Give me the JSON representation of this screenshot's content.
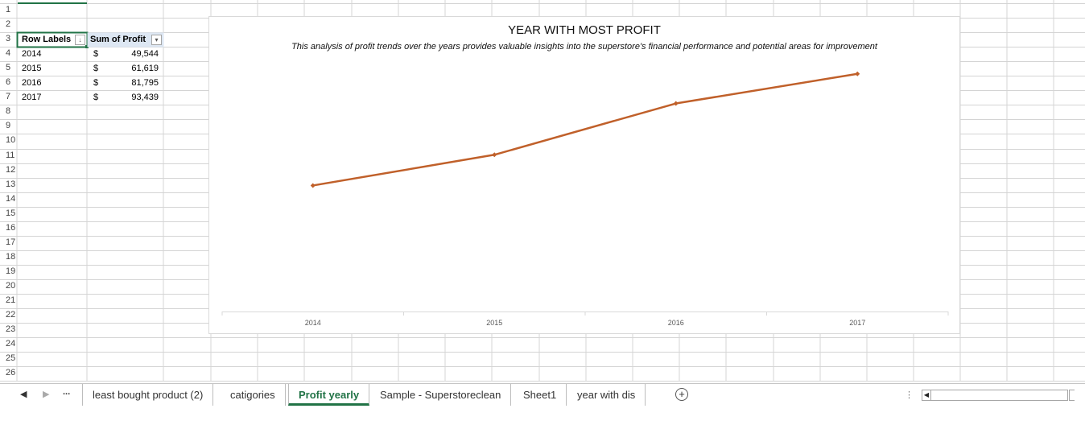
{
  "row_numbers": [
    "1",
    "2",
    "3",
    "4",
    "5",
    "6",
    "7",
    "8",
    "9",
    "10",
    "11",
    "12",
    "13",
    "14",
    "15",
    "16",
    "17",
    "18",
    "19",
    "20",
    "21",
    "22",
    "23",
    "24",
    "25",
    "26"
  ],
  "pivot": {
    "header_row_labels": "Row Labels",
    "header_sum": "Sum of Profit",
    "rows": [
      {
        "year": "2014",
        "currency": "$",
        "value": "49,544"
      },
      {
        "year": "2015",
        "currency": "$",
        "value": "61,619"
      },
      {
        "year": "2016",
        "currency": "$",
        "value": "81,795"
      },
      {
        "year": "2017",
        "currency": "$",
        "value": "93,439"
      }
    ]
  },
  "chart_data": {
    "type": "line",
    "title": "YEAR WITH MOST PROFIT",
    "subtitle": "This analysis of profit trends over the years provides valuable insights into the superstore's financial performance and potential areas for improvement",
    "categories": [
      "2014",
      "2015",
      "2016",
      "2017"
    ],
    "series": [
      {
        "values": [
          49544,
          61619,
          81795,
          93439
        ],
        "color": "#C0602A"
      }
    ],
    "ylim": [
      0,
      100000
    ],
    "grid": false,
    "legend": "none"
  },
  "tabs": {
    "ellipsis": "...",
    "items": [
      {
        "label": "least bought product (2)"
      },
      {
        "label": "catigories"
      },
      {
        "label": "Profit yearly",
        "active": true
      },
      {
        "label": "Sample - Superstoreclean"
      },
      {
        "label": "Sheet1"
      },
      {
        "label": "year with dis"
      }
    ],
    "add": "+"
  },
  "colors": {
    "accent": "#217346",
    "series": "#C0602A",
    "grid": "#d4d4d4"
  }
}
